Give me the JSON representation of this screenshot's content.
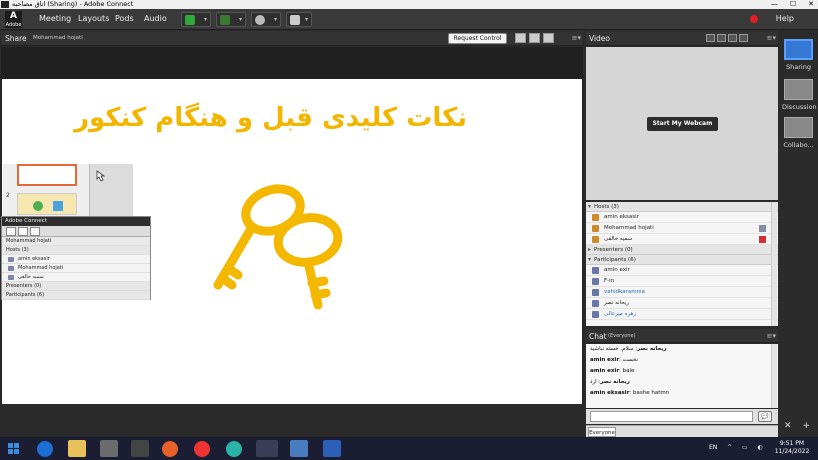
{
  "window": {
    "title": "اتاق مصاحبه (Sharing) - Adobe Connect",
    "minimize": "—",
    "maximize": "☐",
    "close": "✕"
  },
  "menubar": {
    "logo_text": "Adobe",
    "items": [
      "Meeting",
      "Layouts",
      "Pods",
      "Audio"
    ],
    "help": "Help"
  },
  "share_pod": {
    "title": "Share",
    "presenter": "Mohammad hojati",
    "request_control": "Request Control",
    "slide_title": "نکات کلیدی قبل و هنگام کنکور",
    "thumbnail_numbers": [
      "2"
    ]
  },
  "mini_panel": {
    "title": "Adobe Connect",
    "presenter": "Mohammad hojati",
    "sections": {
      "hosts": "Hosts (3)",
      "presenters": "Presenters (0)",
      "participants": "Participants (6)"
    },
    "hosts": [
      "amin eksasir",
      "Mohammad hojati",
      "سمیه خالقی"
    ]
  },
  "video_pod": {
    "title": "Video",
    "webcam_button": "Start My Webcam"
  },
  "attendees": {
    "hosts_label": "Hosts (3)",
    "hosts": [
      "amin eksasir",
      "Mohammad hojati",
      "سمیه خالقی"
    ],
    "presenters_label": "Presenters (0)",
    "participants_label": "Participants (6)",
    "participants": [
      "amin exir",
      "F-in",
      "vahidkaramnia",
      "ریحانه نصر",
      "زهره میرعالی"
    ]
  },
  "chat": {
    "title": "Chat",
    "scope": "(Everyone)",
    "messages": [
      {
        "sender": "ریحانه نصر",
        "text": "سلام. خسته نباشید"
      },
      {
        "sender": "amin exir",
        "text": "نخست"
      },
      {
        "sender": "amin exir",
        "text": "bale"
      },
      {
        "sender": "ریحانه نصر",
        "text": "ارد"
      },
      {
        "sender": "amin eksasir",
        "text": "bashe  hatmn"
      }
    ],
    "send_icon": "💬",
    "tab": "Everyone"
  },
  "layouts": {
    "items": [
      "Sharing",
      "Discussion",
      "Collabo..."
    ],
    "active": 0
  },
  "taskbar": {
    "lang": "EN",
    "time": "9:51 PM",
    "date": "11/24/2022"
  },
  "colors": {
    "slide_title": "#f2b600",
    "key": "#f5b800",
    "layout_active": "#3478d4"
  }
}
